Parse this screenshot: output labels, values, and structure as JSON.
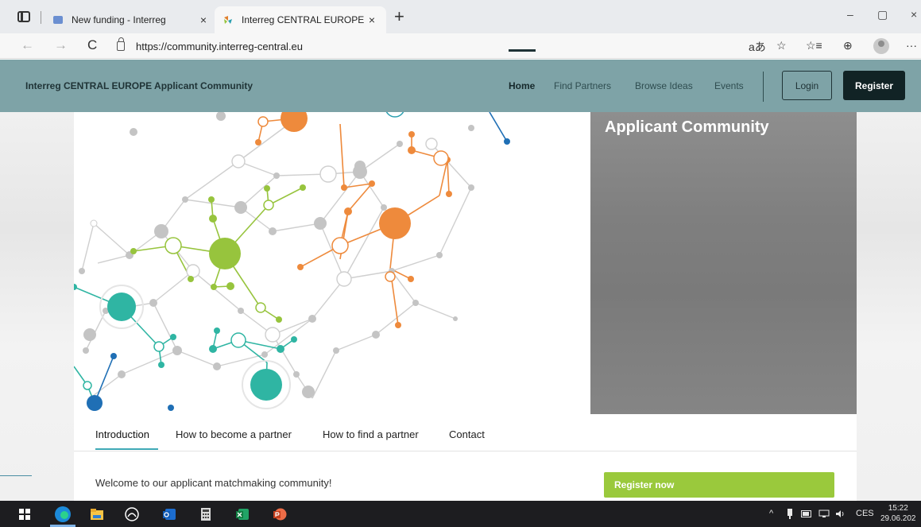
{
  "browser": {
    "tabs": [
      {
        "title": "New funding - Interreg",
        "close": "×"
      },
      {
        "title": "Interreg CENTRAL EUROPE Appl",
        "close": "×"
      }
    ],
    "new_tab": "+",
    "url": "https://community.interreg-central.eu",
    "window_controls": {
      "minimize": "–",
      "maximize": "▢",
      "close": "×"
    },
    "nav_icons": {
      "back": "←",
      "forward": "→",
      "refresh": "C"
    },
    "toolbar_icons": {
      "read_aloud": "aあ",
      "favorite": "☆",
      "favorites": "☆≡",
      "collections": "⊕",
      "more": "···"
    }
  },
  "site": {
    "brand": "Interreg CENTRAL EUROPE Applicant Community",
    "nav": [
      {
        "label": "Home"
      },
      {
        "label": "Find Partners"
      },
      {
        "label": "Browse Ideas"
      },
      {
        "label": "Events"
      }
    ],
    "login": "Login",
    "register": "Register"
  },
  "hero": {
    "title": "Applicant Community"
  },
  "content": {
    "tabs": [
      {
        "label": "Introduction"
      },
      {
        "label": "How to become a partner"
      },
      {
        "label": "How to find a partner"
      },
      {
        "label": "Contact"
      }
    ],
    "welcome": "Welcome to our applicant matchmaking community!",
    "cta": "Register now"
  },
  "taskbar": {
    "language": "CES",
    "time": "15:22",
    "date": "29.06.202"
  },
  "colors": {
    "header_bg": "#7ea3a7",
    "register_bg": "#112325",
    "cta_green": "#9ac93c",
    "tab_accent": "#3fa9b5",
    "node_orange": "#ee8a3c",
    "node_green": "#97c43d",
    "node_teal": "#2fb5a3",
    "node_blue": "#1f6fb5",
    "node_grey": "#c4c4c4"
  }
}
